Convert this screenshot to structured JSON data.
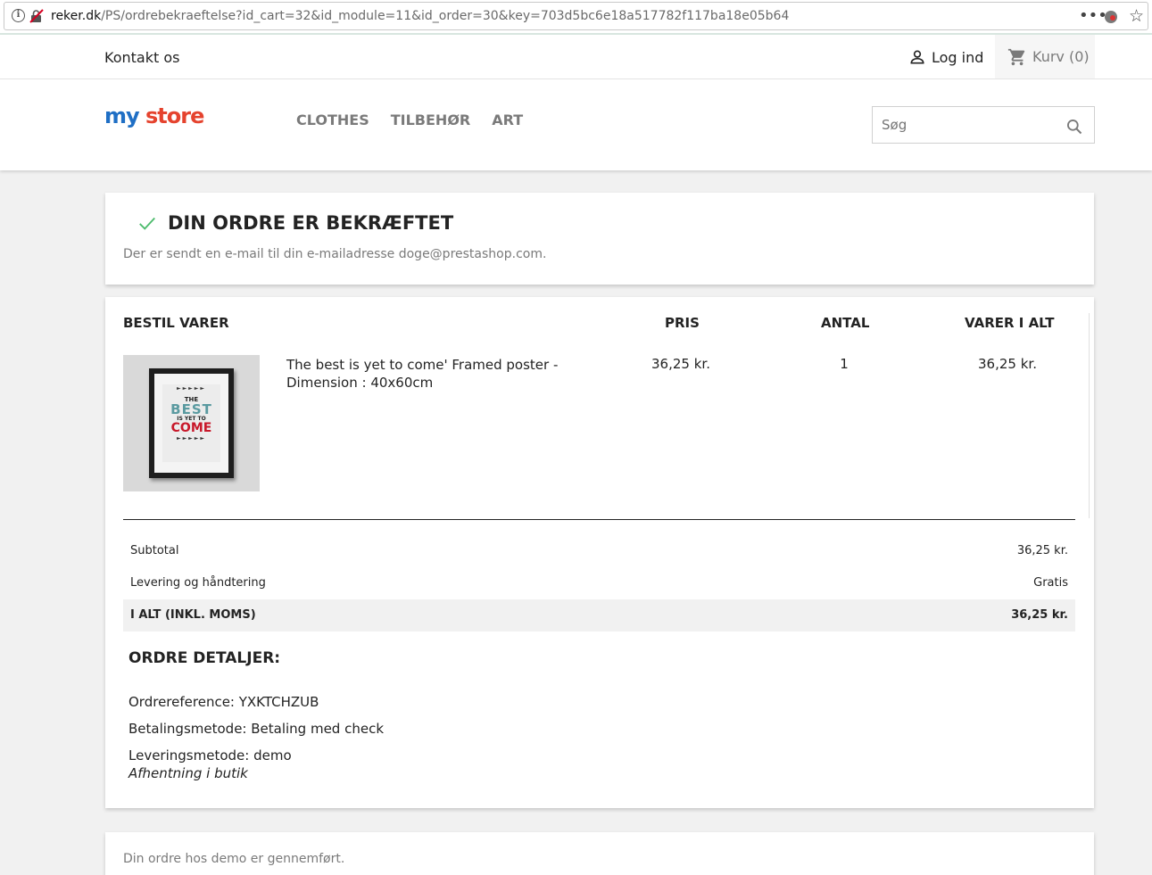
{
  "browser": {
    "url_domain": "reker.dk",
    "url_path": "/PS/ordrebekraeftelse?id_cart=32&id_module=11&id_order=30&key=703d5bc6e18a517782f117ba18e05b64",
    "menu_glyph": "•••",
    "star_glyph": "☆"
  },
  "nav": {
    "contact": "Kontakt os",
    "login": "Log ind",
    "cart": "Kurv (0)"
  },
  "header": {
    "logo": {
      "part1": "my ",
      "part2": "store"
    },
    "menu": [
      "CLOTHES",
      "TILBEHØR",
      "ART"
    ],
    "search_placeholder": "Søg"
  },
  "confirmation": {
    "title": "DIN ORDRE ER BEKRÆFTET",
    "subtitle": "Der er sendt en e-mail til din e-mailadresse doge@prestashop.com."
  },
  "order": {
    "headers": {
      "item": "BESTIL VARER",
      "price": "PRIS",
      "qty": "ANTAL",
      "total": "VARER I ALT"
    },
    "product": {
      "name": "The best is yet to come' Framed poster - Dimension : 40x60cm",
      "price": "36,25 kr.",
      "qty": "1",
      "total": "36,25 kr.",
      "poster": {
        "l1": "THE",
        "l2": "BEST",
        "l3": "IS YET TO",
        "l4": "COME",
        "arrows": "►►►►►"
      }
    },
    "totals": [
      {
        "label": "Subtotal",
        "value": "36,25 kr."
      },
      {
        "label": "Levering og håndtering",
        "value": "Gratis"
      },
      {
        "label": "I ALT (INKL. MOMS)",
        "value": "36,25 kr."
      }
    ],
    "details": {
      "title": "ORDRE DETALJER:",
      "reference": "Ordrereference: YXKTCHZUB",
      "payment": "Betalingsmetode: Betaling med check",
      "delivery": "Leveringsmetode: demo",
      "delivery_note": "Afhentning i butik"
    }
  },
  "footer_card": {
    "text": "Din ordre hos demo er gennemført."
  },
  "colors": {
    "accent": "#24b9d7",
    "check": "#4cbb6c",
    "muted": "#7a7a7a",
    "logo_red": "#e5432e"
  }
}
